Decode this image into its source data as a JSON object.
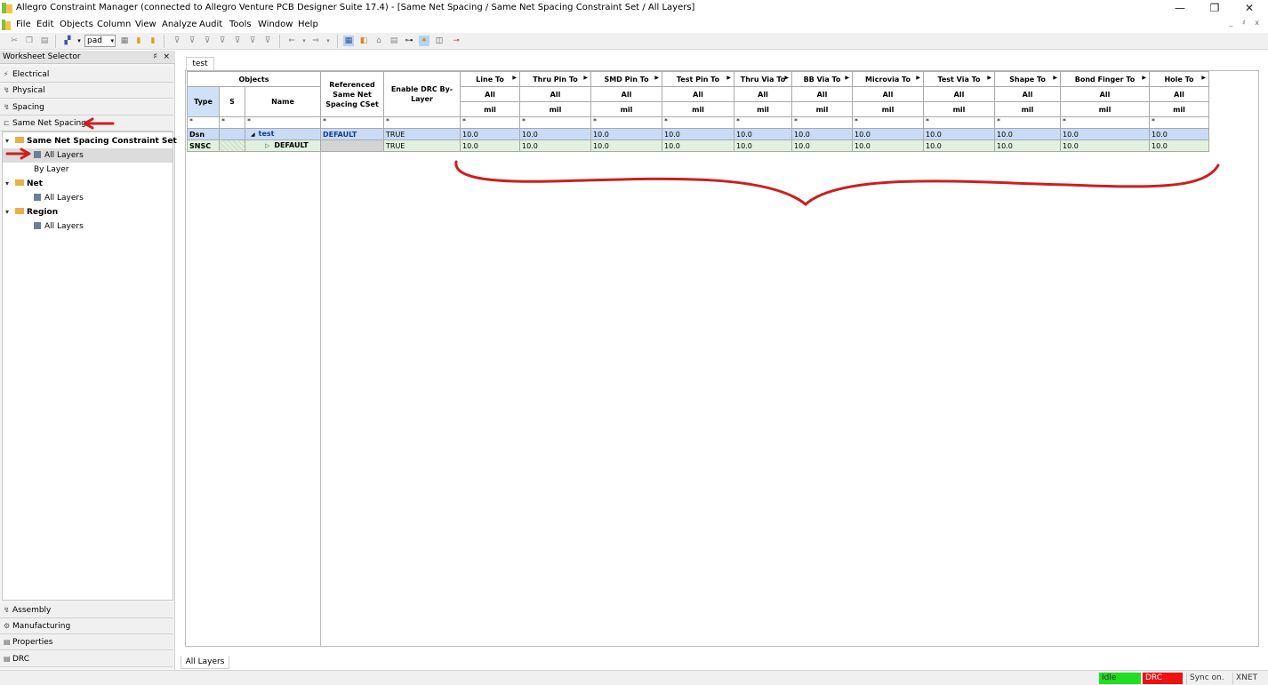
{
  "window": {
    "title": "Allegro Constraint Manager (connected to Allegro Venture PCB Designer Suite 17.4) - [Same Net Spacing / Same Net Spacing Constraint Set / All Layers]",
    "minimize": "—",
    "restore": "❐",
    "close": "✕"
  },
  "menu": [
    "File",
    "Edit",
    "Objects",
    "Column",
    "View",
    "Analyze",
    "Audit",
    "Tools",
    "Window",
    "Help"
  ],
  "mdi_buttons": "_ ♯ x",
  "toolbar": {
    "select_value": "pad",
    "select_arrow": "▾"
  },
  "worksheet": {
    "header": "Worksheet Selector",
    "pin": "♯ ×",
    "categories_top": [
      {
        "label": "Electrical",
        "icon": "⚡"
      },
      {
        "label": "Physical",
        "icon": "↯"
      },
      {
        "label": "Spacing",
        "icon": "↯"
      },
      {
        "label": "Same Net Spacing",
        "icon": "⊏"
      }
    ],
    "categories_bottom": [
      {
        "label": "Assembly",
        "icon": "↯"
      },
      {
        "label": "Manufacturing",
        "icon": "⚙"
      },
      {
        "label": "Properties",
        "icon": "▤"
      },
      {
        "label": "DRC",
        "icon": "▤"
      }
    ],
    "tree": [
      {
        "label": "Same Net Spacing Constraint Set",
        "level": 0,
        "twisty": "▾",
        "bold": true
      },
      {
        "label": "All Layers",
        "level": 1,
        "selected": true
      },
      {
        "label": "By Layer",
        "level": 1
      },
      {
        "label": "Net",
        "level": 0,
        "twisty": "▾",
        "bold": true
      },
      {
        "label": "All Layers",
        "level": 1
      },
      {
        "label": "Region",
        "level": 0,
        "twisty": "▾",
        "bold": true
      },
      {
        "label": "All Layers",
        "level": 1
      }
    ]
  },
  "tabs": {
    "top": "test",
    "bottom": "All Layers"
  },
  "grid": {
    "objects_header": "Objects",
    "type_header": "Type",
    "s_header": "S",
    "name_header": "Name",
    "ref_header": "Referenced Same Net Spacing CSet",
    "drc_header": "Enable DRC By-Layer",
    "columns": [
      {
        "label": "Line To",
        "sub": "All",
        "unit": "mil"
      },
      {
        "label": "Thru Pin To",
        "sub": "All",
        "unit": "mil"
      },
      {
        "label": "SMD Pin To",
        "sub": "All",
        "unit": "mil"
      },
      {
        "label": "Test Pin To",
        "sub": "All",
        "unit": "mil"
      },
      {
        "label": "Thru Via To",
        "sub": "All",
        "unit": "mil"
      },
      {
        "label": "BB Via To",
        "sub": "All",
        "unit": "mil"
      },
      {
        "label": "Microvia To",
        "sub": "All",
        "unit": "mil"
      },
      {
        "label": "Test Via To",
        "sub": "All",
        "unit": "mil"
      },
      {
        "label": "Shape To",
        "sub": "All",
        "unit": "mil"
      },
      {
        "label": "Bond Finger To",
        "sub": "All",
        "unit": "mil"
      },
      {
        "label": "Hole To",
        "sub": "All",
        "unit": "mil"
      }
    ],
    "filter": "*",
    "rows": [
      {
        "type": "Dsn",
        "s": "",
        "twisty": "◢",
        "name": "test",
        "ref": "DEFAULT",
        "drc": "TRUE",
        "values": [
          "10.0",
          "10.0",
          "10.0",
          "10.0",
          "10.0",
          "10.0",
          "10.0",
          "10.0",
          "10.0",
          "10.0",
          "10.0"
        ]
      },
      {
        "type": "SNSC",
        "s": "",
        "twisty": "▷",
        "name": "DEFAULT",
        "ref": "",
        "drc": "TRUE",
        "values": [
          "10.0",
          "10.0",
          "10.0",
          "10.0",
          "10.0",
          "10.0",
          "10.0",
          "10.0",
          "10.0",
          "10.0",
          "10.0"
        ]
      }
    ]
  },
  "status": {
    "idle": {
      "label": "Idle",
      "color": "#22dd22"
    },
    "drc": {
      "label": "DRC",
      "color": "#ee1111"
    },
    "sync": "Sync on.",
    "xnet": "XNET"
  },
  "annotation_color": "#cc1f1f"
}
